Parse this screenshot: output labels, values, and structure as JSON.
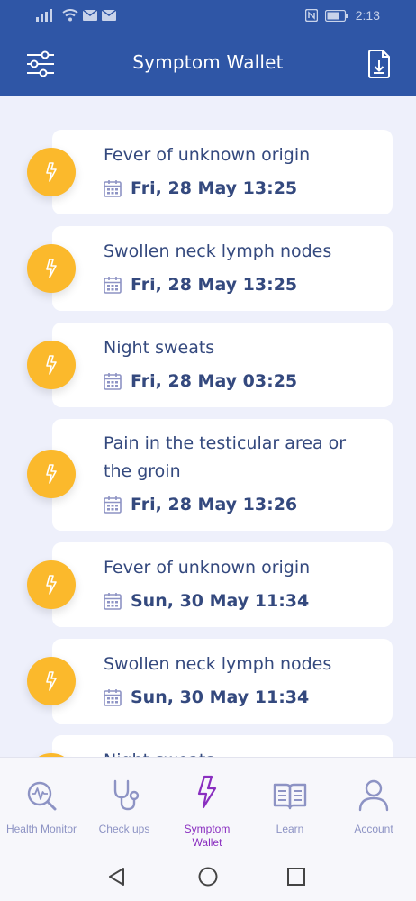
{
  "status_bar": {
    "time": "2:13",
    "icons": [
      "signal-icon",
      "wifi-icon",
      "mail-icon",
      "mail-icon",
      "nfc-icon",
      "battery-icon"
    ]
  },
  "app_bar": {
    "title": "Symptom Wallet",
    "left_icon": "filter-sliders-icon",
    "right_icon": "export-document-icon"
  },
  "symptoms": [
    {
      "title": "Fever of unknown origin",
      "date": "Fri, 28 May 13:25"
    },
    {
      "title": "Swollen neck lymph nodes",
      "date": "Fri, 28 May 13:25"
    },
    {
      "title": "Night sweats",
      "date": "Fri, 28 May 03:25"
    },
    {
      "title": "Pain in the testicular area or the groin",
      "date": "Fri, 28 May 13:26"
    },
    {
      "title": "Fever of unknown origin",
      "date": "Sun, 30 May 11:34"
    },
    {
      "title": "Swollen neck lymph nodes",
      "date": "Sun, 30 May 11:34"
    },
    {
      "title": "Night sweats",
      "date": ""
    }
  ],
  "bottom_nav": {
    "items": [
      {
        "label": "Health Monitor",
        "icon": "health-monitor-icon"
      },
      {
        "label": "Check ups",
        "icon": "stethoscope-icon"
      },
      {
        "label": "Symptom Wallet",
        "icon": "lightning-icon",
        "active": true
      },
      {
        "label": "Learn",
        "icon": "book-icon"
      },
      {
        "label": "Account",
        "icon": "person-icon"
      }
    ]
  },
  "colors": {
    "primary": "#2f56a6",
    "accent": "#fbb92c",
    "text": "#34497e",
    "active_nav": "#8a2fc0",
    "inactive_nav": "#8d93c4",
    "background": "#eef0fb"
  }
}
